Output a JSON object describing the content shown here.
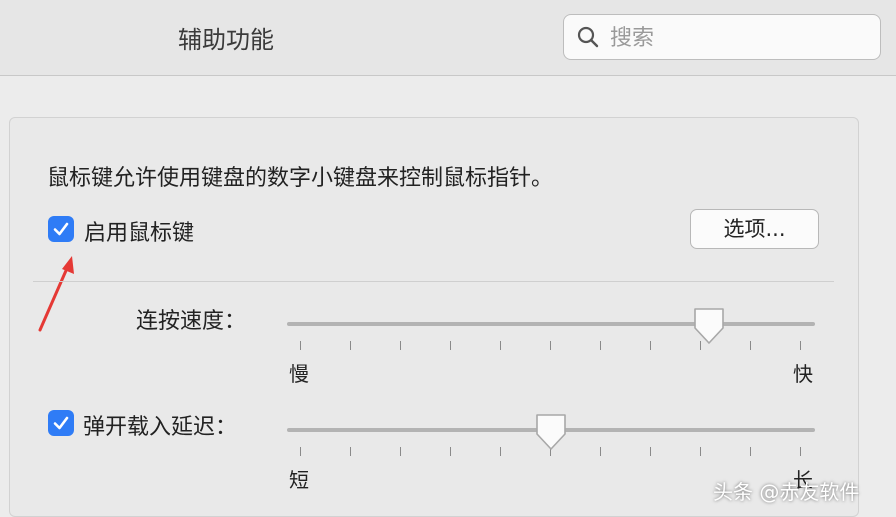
{
  "window": {
    "title": "辅助功能"
  },
  "search": {
    "placeholder": "搜索"
  },
  "panel": {
    "description": "鼠标键允许使用键盘的数字小键盘来控制鼠标指针。",
    "enable_mouse_keys": {
      "label": "启用鼠标键",
      "checked": true
    },
    "options_button": "选项...",
    "click_speed": {
      "label": "连按速度：",
      "min_label": "慢",
      "max_label": "快",
      "value": 0.8
    },
    "spring_delay": {
      "label": "弹开载入延迟：",
      "checked": true,
      "min_label": "短",
      "max_label": "长",
      "value": 0.5
    }
  },
  "watermark": "头条 @赤友软件",
  "colors": {
    "accent": "#2f7cf6",
    "arrow": "#e53935"
  },
  "icons": [
    "search-icon",
    "checkmark-icon",
    "slider-thumb",
    "red-arrow"
  ]
}
